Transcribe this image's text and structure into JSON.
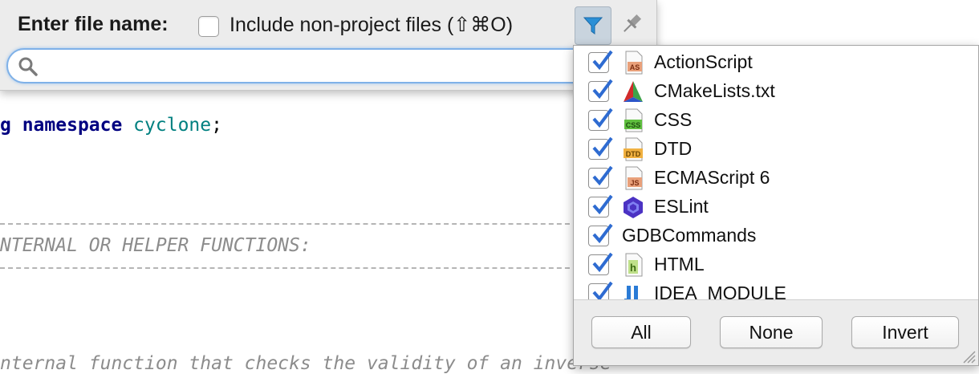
{
  "popup": {
    "title": "Enter file name:",
    "include_non_project_label": "Include non-project files (⇧⌘O)",
    "include_non_project_checked": false,
    "search_value": "",
    "filter_icon": "filter-icon",
    "pin_icon": "pin-icon",
    "search_icon": "search-icon"
  },
  "editor": {
    "line1": {
      "kw_prefix": "g ",
      "kw": "namespace",
      "ns": " cyclone",
      "end": ";"
    },
    "comment1": "NTERNAL OR HELPER FUNCTIONS:",
    "comment2": "nternal function that checks the validity of an inverse"
  },
  "filter": {
    "items": [
      {
        "label": "ActionScript",
        "checked": true,
        "icon": "actionscript-file-icon",
        "badge": "AS"
      },
      {
        "label": "CMakeLists.txt",
        "checked": true,
        "icon": "cmake-icon",
        "badge": ""
      },
      {
        "label": "CSS",
        "checked": true,
        "icon": "css-file-icon",
        "badge": "CSS"
      },
      {
        "label": "DTD",
        "checked": true,
        "icon": "dtd-file-icon",
        "badge": "DTD"
      },
      {
        "label": "ECMAScript 6",
        "checked": true,
        "icon": "javascript-file-icon",
        "badge": "JS"
      },
      {
        "label": "ESLint",
        "checked": true,
        "icon": "eslint-icon",
        "badge": ""
      },
      {
        "label": "GDBCommands",
        "checked": true,
        "icon": "",
        "badge": ""
      },
      {
        "label": "HTML",
        "checked": true,
        "icon": "html-file-icon",
        "badge": "h"
      },
      {
        "label": "IDEA_MODULE",
        "checked": true,
        "icon": "idea-module-icon",
        "badge": ""
      }
    ],
    "buttons": {
      "all": "All",
      "none": "None",
      "invert": "Invert"
    },
    "accent": "#2e6bd1"
  }
}
